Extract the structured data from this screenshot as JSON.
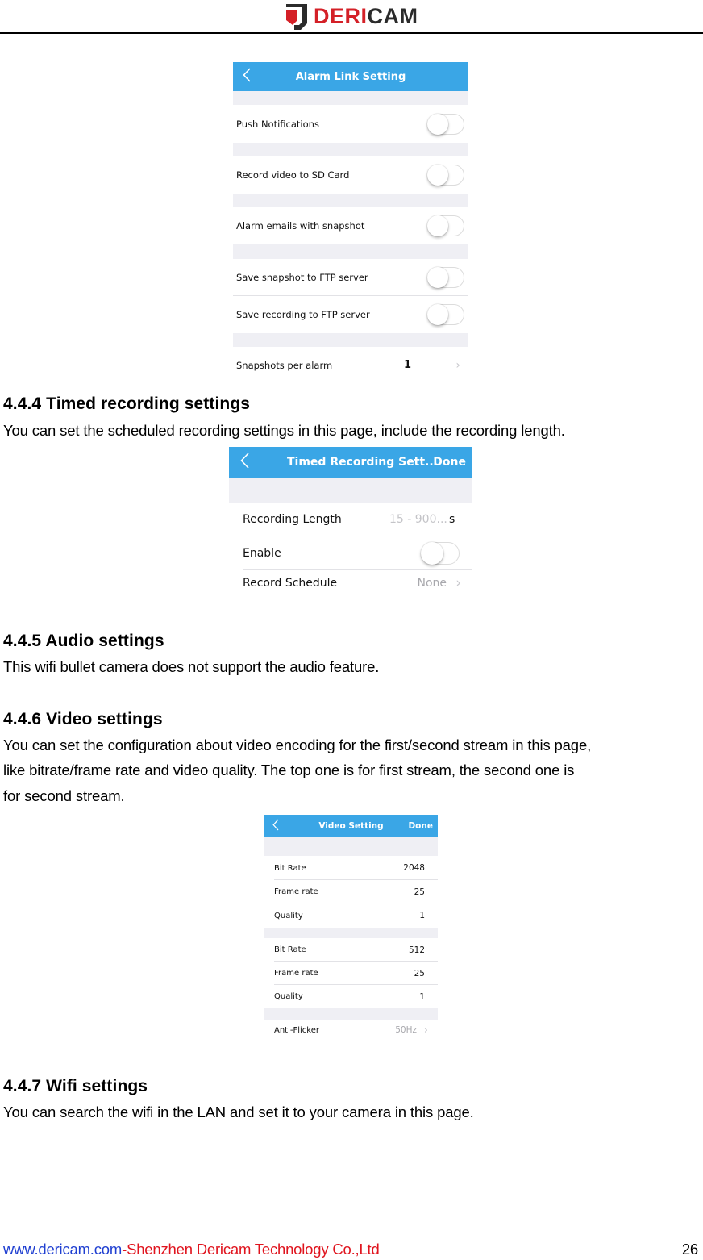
{
  "header": {
    "logo": {
      "icon": "dericam-shield-icon",
      "text_red": "DERI",
      "text_dark": "CAM"
    },
    "colors": {
      "brand_red": "#d42027",
      "brand_dark": "#2b2b2b"
    }
  },
  "screenshots": {
    "alarm_link": {
      "title": "Alarm Link Setting",
      "back_icon": "chevron-left-icon",
      "rows": [
        {
          "label": "Push Notifications",
          "type": "toggle",
          "on": false
        },
        {
          "label": "Record video to SD Card",
          "type": "toggle",
          "on": false
        },
        {
          "label": "Alarm emails with snapshot",
          "type": "toggle",
          "on": false
        },
        {
          "label": "Save snapshot to FTP server",
          "type": "toggle",
          "on": false
        },
        {
          "label": "Save recording to FTP server",
          "type": "toggle",
          "on": false
        },
        {
          "label": "Snapshots per alarm",
          "type": "value",
          "value": "1"
        }
      ]
    },
    "timed_recording": {
      "title": "Timed Recording Sett...",
      "done": "Done",
      "back_icon": "chevron-left-icon",
      "rows": [
        {
          "label": "Recording Length",
          "placeholder": "15 - 900...",
          "unit": "s"
        },
        {
          "label": "Enable",
          "type": "toggle",
          "on": false
        },
        {
          "label": "Record Schedule",
          "value": "None"
        }
      ]
    },
    "video_setting": {
      "title": "Video Setting",
      "done": "Done",
      "back_icon": "chevron-left-icon",
      "first_stream": [
        {
          "label": "Bit Rate",
          "value": "2048"
        },
        {
          "label": "Frame rate",
          "value": "25"
        },
        {
          "label": "Quality",
          "value": "1"
        }
      ],
      "second_stream": [
        {
          "label": "Bit Rate",
          "value": "512"
        },
        {
          "label": "Frame rate",
          "value": "25"
        },
        {
          "label": "Quality",
          "value": "1"
        }
      ],
      "anti_flicker": {
        "label": "Anti-Flicker",
        "value": "50Hz"
      }
    },
    "colors": {
      "navbar": "#3aa6e6",
      "group_bg": "#efeff4"
    }
  },
  "sections": {
    "timed": {
      "heading": "4.4.4 Timed recording settings",
      "body": "You can set the scheduled recording settings in this page, include the recording length."
    },
    "audio": {
      "heading": "4.4.5 Audio settings",
      "body": "This wifi bullet camera does not support the audio feature."
    },
    "video": {
      "heading": "4.4.6 Video settings",
      "body_lines": [
        "You can set the configuration about video encoding for the first/second stream in this page,",
        "like bitrate/frame rate and video quality. The top one is for first stream, the second one is",
        "for second stream."
      ]
    },
    "wifi": {
      "heading": "4.4.7 Wifi settings",
      "body": "You can search the wifi in the LAN and set it to your camera in this page."
    }
  },
  "footer": {
    "url": "www.dericam.com",
    "separator": "-",
    "company": "Shenzhen Dericam Technology Co.,Ltd",
    "page_number": "26",
    "colors": {
      "url": "#1f3fd1",
      "company": "#e0141e"
    }
  }
}
